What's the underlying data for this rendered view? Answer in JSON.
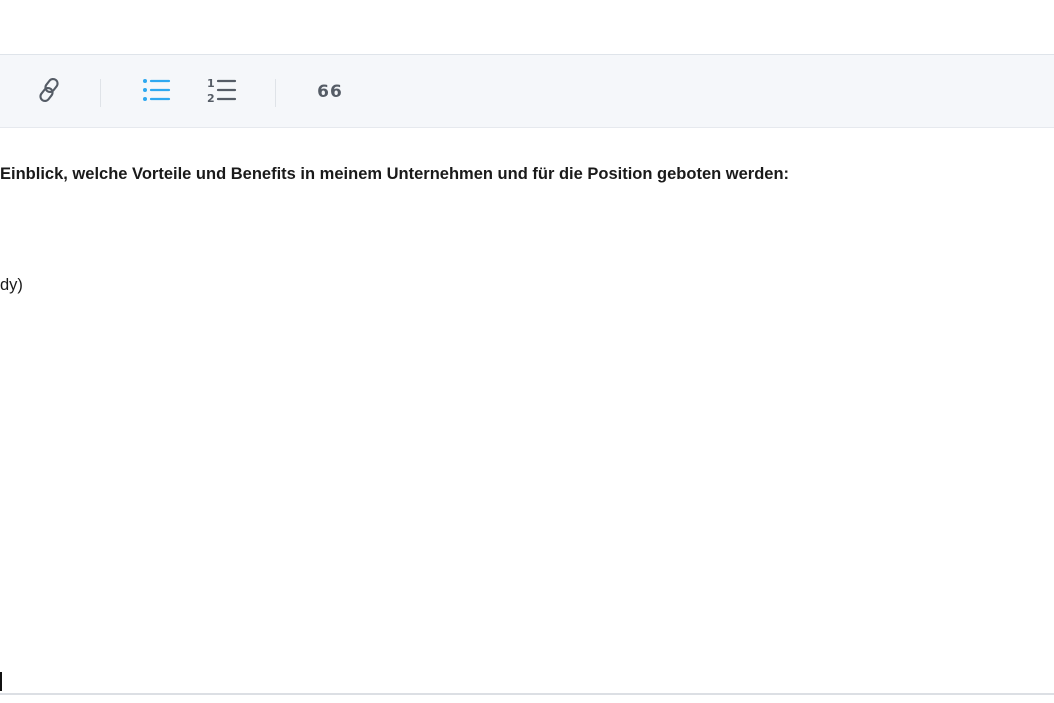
{
  "toolbar": {
    "buttons": [
      {
        "name": "link",
        "icon": "link-icon"
      },
      {
        "name": "bullet-list",
        "icon": "bullet-list-icon",
        "active": true
      },
      {
        "name": "numbered-list",
        "icon": "numbered-list-icon"
      },
      {
        "name": "blockquote",
        "label": "66"
      }
    ]
  },
  "editor": {
    "lines": [
      {
        "text": "Einblick, welche Vorteile und Benefits in meinem Unternehmen und für die Position geboten werden:",
        "bold": true
      },
      {
        "text": "dy)",
        "bold": false
      }
    ]
  },
  "colors": {
    "accent": "#2ea8f0",
    "icon": "#555c66",
    "toolbar_bg": "#f5f7fa"
  }
}
